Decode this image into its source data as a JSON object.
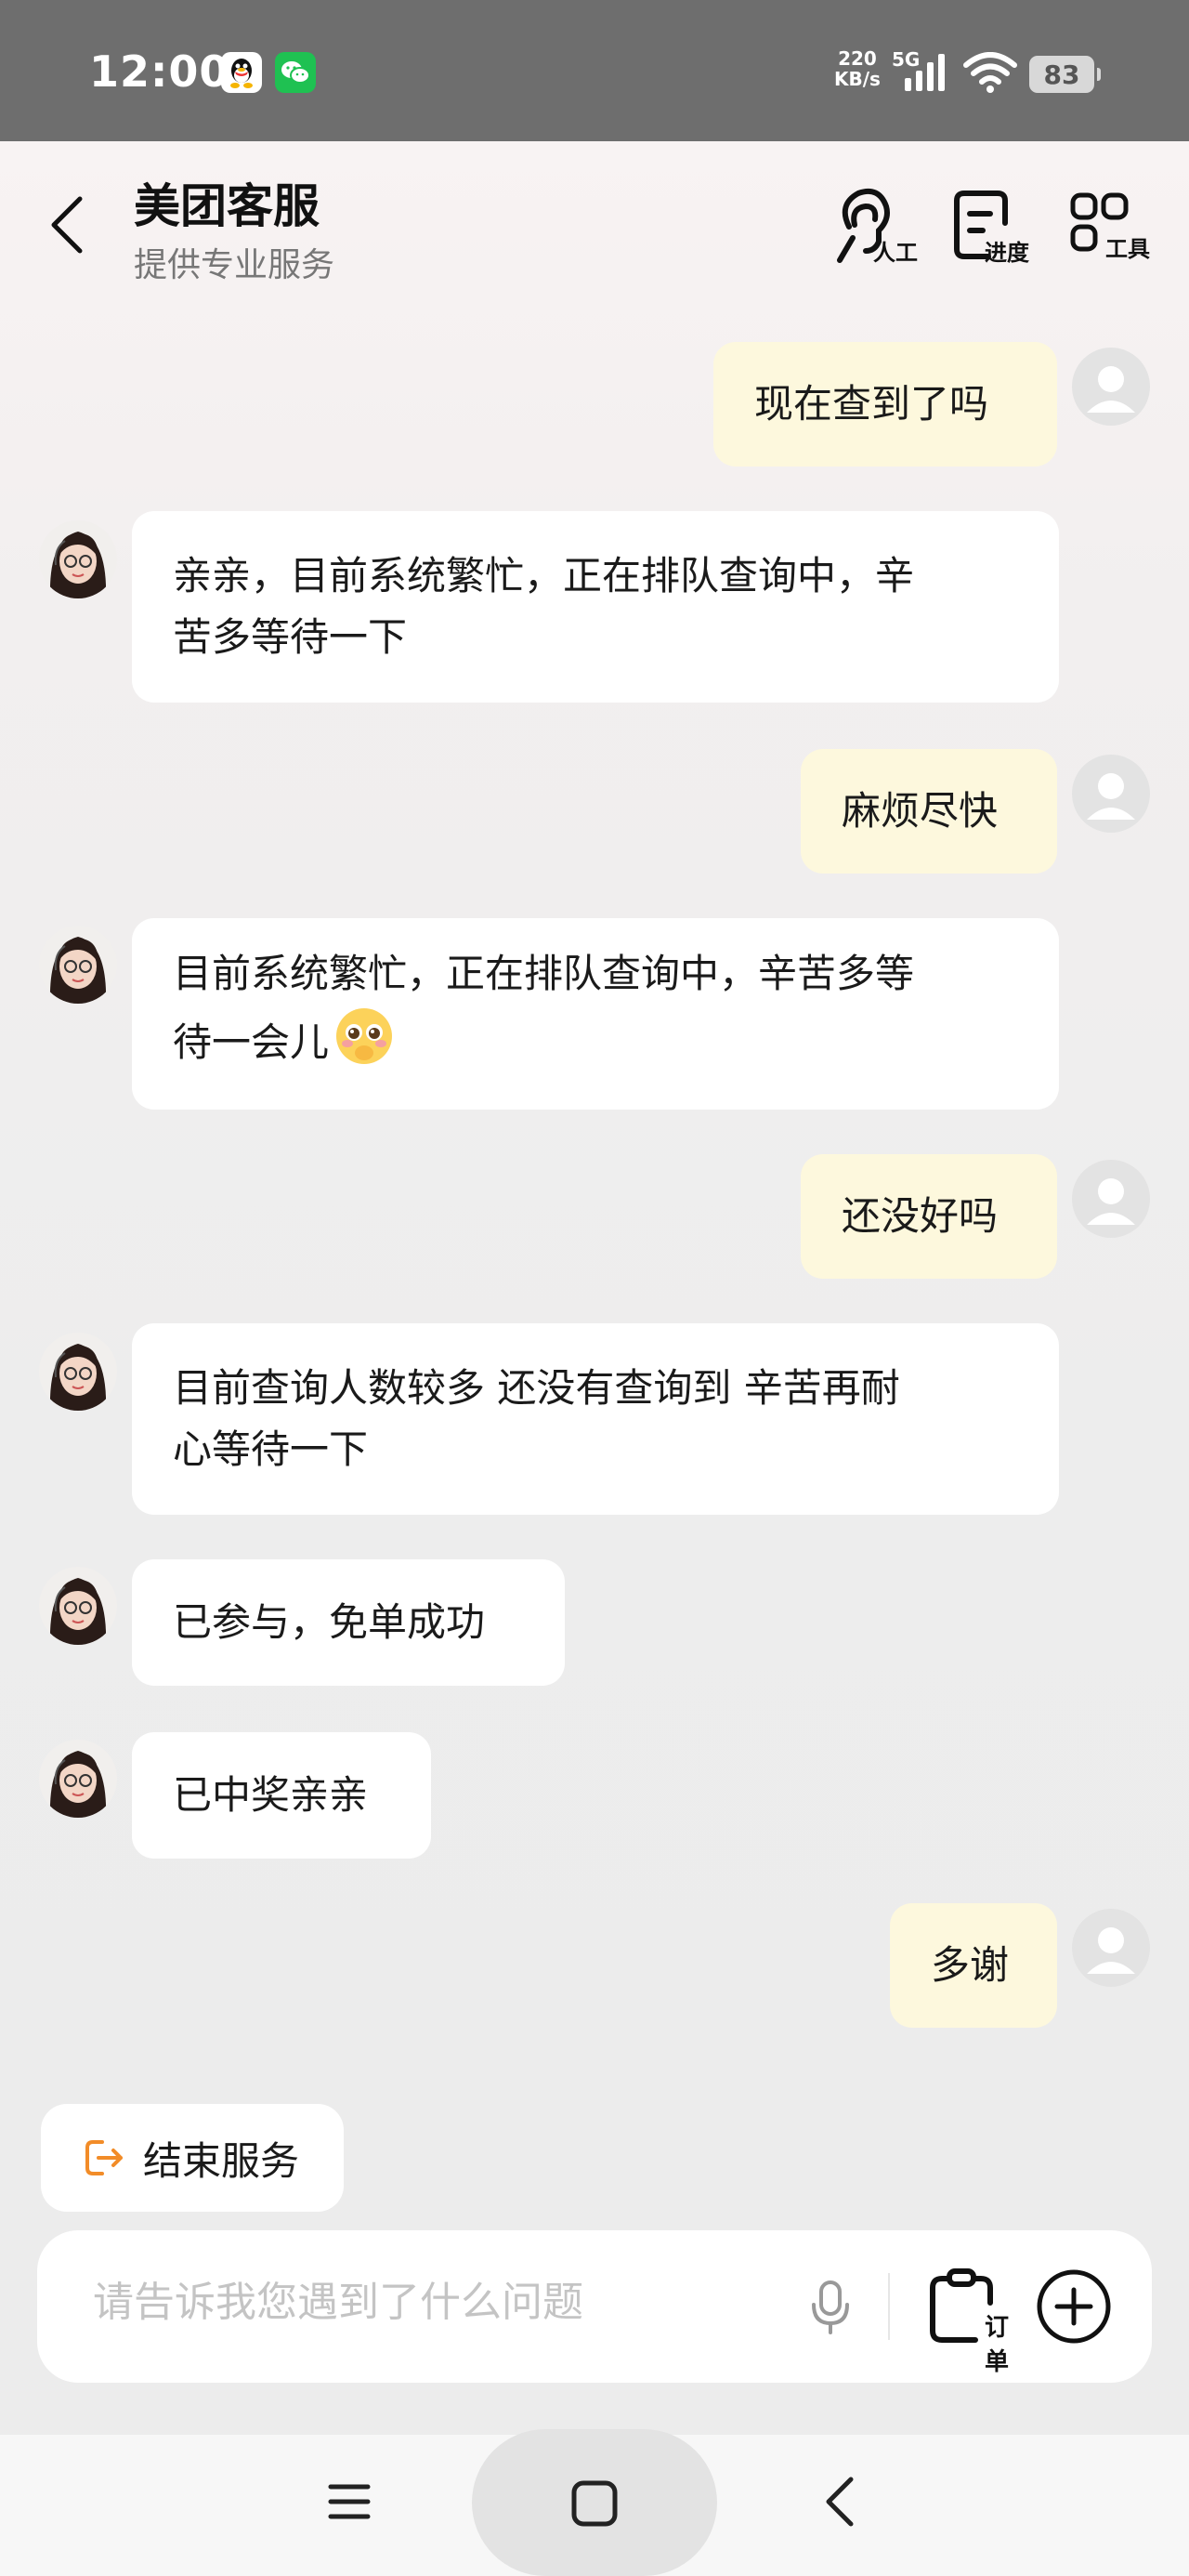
{
  "status_bar": {
    "time": "12:00",
    "net_speed_value": "220",
    "net_speed_unit": "KB/s",
    "network": "5G",
    "battery": "83",
    "app_icons": [
      "qq-icon",
      "wechat-icon"
    ]
  },
  "header": {
    "title": "美团客服",
    "subtitle": "提供专业服务",
    "tools": [
      {
        "label": "人工",
        "icon": "human-agent-icon"
      },
      {
        "label": "进度",
        "icon": "progress-icon"
      },
      {
        "label": "工具",
        "icon": "tools-grid-icon"
      }
    ]
  },
  "messages": [
    {
      "sender": "user",
      "text": "现在查到了吗"
    },
    {
      "sender": "agent",
      "lines": [
        "亲亲，目前系统繁忙，正在排队查询中，辛",
        "苦多等待一下"
      ]
    },
    {
      "sender": "user",
      "text": "麻烦尽快"
    },
    {
      "sender": "agent",
      "lines": [
        "目前系统繁忙，正在排队查询中，辛苦多等",
        "待一会儿"
      ],
      "emoji": "pleading-face-emoji"
    },
    {
      "sender": "user",
      "text": "还没好吗"
    },
    {
      "sender": "agent",
      "lines": [
        "目前查询人数较多 还没有查询到 辛苦再耐",
        "心等待一下"
      ]
    },
    {
      "sender": "agent",
      "text": "已参与，免单成功"
    },
    {
      "sender": "agent",
      "text": "已中奖亲亲"
    },
    {
      "sender": "user",
      "text": "多谢"
    }
  ],
  "end_service": {
    "label": "结束服务"
  },
  "input": {
    "placeholder": "请告诉我您遇到了什么问题",
    "order_label": "订单"
  },
  "colors": {
    "user_bubble": "#fdf8dd",
    "agent_bubble": "#ffffff",
    "accent_orange": "#f28c28",
    "status_bar": "#6e6e6e"
  }
}
